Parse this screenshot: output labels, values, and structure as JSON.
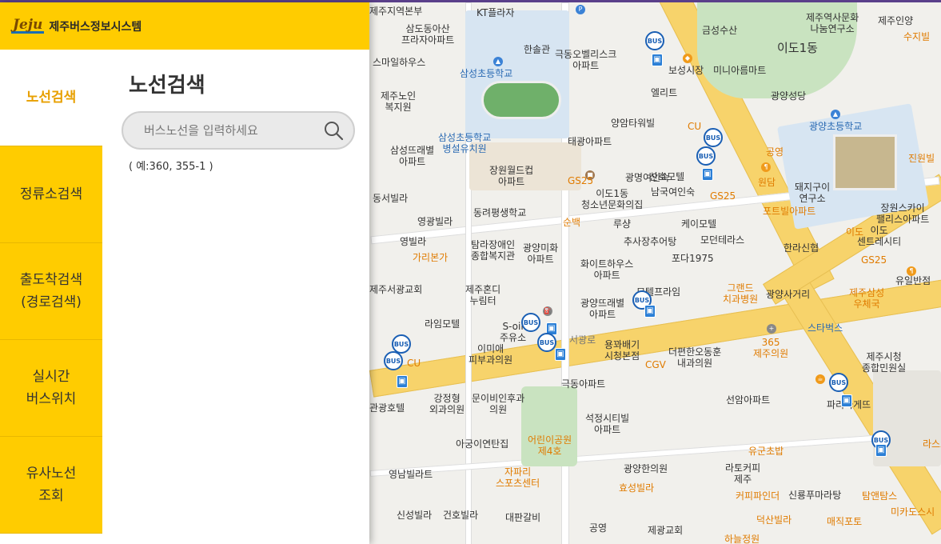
{
  "app": {
    "logo_mark": "Jeju",
    "logo_title": "제주버스정보시스템"
  },
  "nav": [
    {
      "label": "노선검색",
      "active": true
    },
    {
      "label": "정류소검색",
      "active": false
    },
    {
      "label": "출도착검색\n(경로검색)",
      "active": false
    },
    {
      "label": "실시간\n버스위치",
      "active": false
    },
    {
      "label": "유사노선\n조회",
      "active": false
    }
  ],
  "route_search": {
    "title": "노선검색",
    "placeholder": "버스노선을 입력하세요",
    "value": "",
    "hint": "( 예:360, 355-1 )"
  },
  "map": {
    "labels": [
      "제주지역본부",
      "KT플라자",
      "삼도동아산 프라자아파트",
      "한솔관",
      "극동오벨리스크 아파트",
      "스마일하우스",
      "삼성초등학교",
      "제주노인 복지원",
      "삼성초등학교 병설유치원",
      "삼성뜨래별 아파트",
      "장원월드컵 아파트",
      "태광아파트",
      "양암타워빌",
      "광명여인숙",
      "산호모텔",
      "남국여인숙",
      "이도1동 청소년문화의집",
      "동서빌라",
      "동려평생학교",
      "영광빌라",
      "영빌라",
      "가리본가",
      "탐라장애인 종합복지관",
      "광양미화 아파트",
      "제주서광교회",
      "제주혼디 누림터",
      "화이트하우스 아파트",
      "광양뜨래별 아파트",
      "모텔프라임",
      "라임모텔",
      "S-oil 주유소",
      "이미애 피부과의원",
      "서광로",
      "용꽈배기 시청본점",
      "CGV",
      "더편한오동훈 내과의원",
      "극동아파트",
      "강정형 외과의원",
      "문이비인후과 의원",
      "관광호텔",
      "어린이공원 제4호",
      "석정시티빌 아파트",
      "아궁이연탄집",
      "자파리 스포츠센터",
      "영남빌라트",
      "신성빌라",
      "건호빌라",
      "대판갈비",
      "공영",
      "광양한의원",
      "효성빌라",
      "제광교회",
      "금성수산",
      "이도1동",
      "제주역사문화 나눔연구소",
      "제주인양",
      "수지빌",
      "보성시장",
      "미니아름마트",
      "엘리트",
      "광양성당",
      "광양초등학교",
      "CU",
      "공영",
      "원담",
      "돼지구이 연구소",
      "포트빌아파트",
      "케이모텔",
      "모던테라스",
      "한라신협",
      "장원스카이 팰리스아파트",
      "이도 센트레시티",
      "포다1975",
      "유일반점",
      "제주삼성 우체국",
      "그랜드 치과병원",
      "광양사거리",
      "스타벅스",
      "365 제주의원",
      "제주시청 종합민원실",
      "선암아파트",
      "파리바게뜨",
      "유군초밥",
      "라토커피 제주",
      "커피파인더",
      "신룡푸마라탕",
      "탐앤탐스",
      "미카도스시",
      "덕산빌라",
      "매직포토",
      "하늘정원",
      "추사장추어탕",
      "루샹",
      "순백",
      "GS25",
      "GS25",
      "GS25",
      "CU",
      "진원빌",
      "이도",
      "라스또"
    ]
  }
}
